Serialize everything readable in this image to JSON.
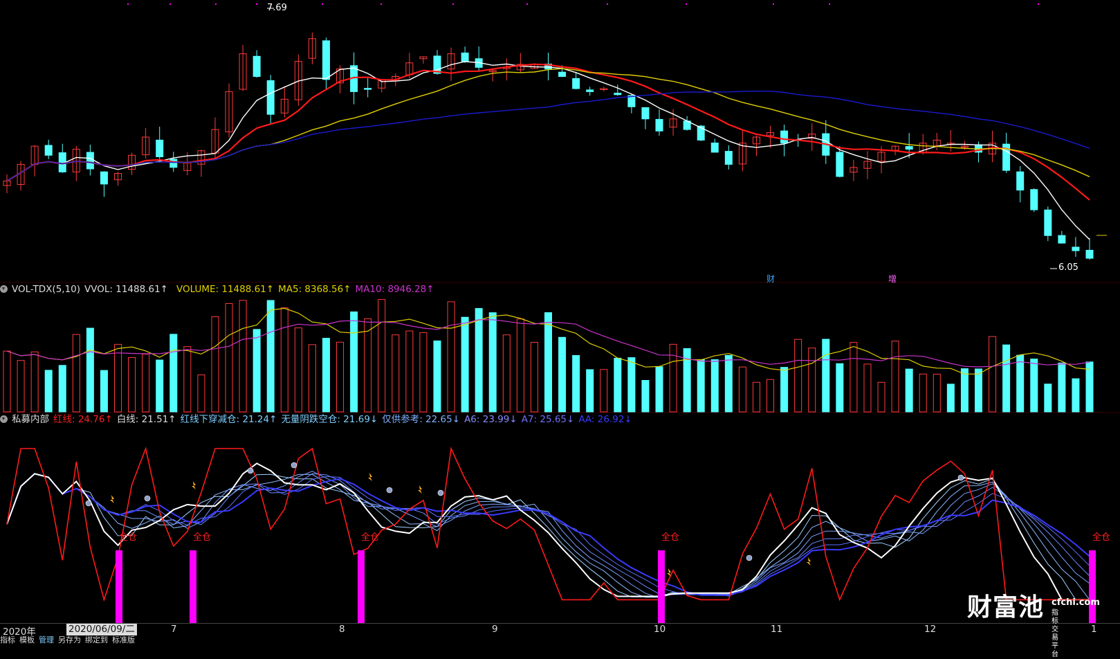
{
  "price_panel": {
    "high_label": "7.69",
    "low_label": "6.05",
    "event_tags": [
      "财",
      "增"
    ]
  },
  "volume_panel": {
    "indicator_name": "VOL-TDX(5,10)",
    "vvol": "VVOL: 11488.61↑",
    "volume": "VOLUME: 11488.61↑",
    "ma5": "MA5: 8368.56↑",
    "ma10": "MA10: 8946.28↑"
  },
  "indicator_panel": {
    "name": "私募内部",
    "red_line": "红线: 24.76↑",
    "white_line": "白线: 21.51↑",
    "red_cross": "红线下穿减仓: 21.24↑",
    "no_bear": "无量阴跌空仓: 21.69↓",
    "reference": "仅供参考: 22.65↓",
    "a6": "A6: 23.99↓",
    "a7": "A7: 25.65↓",
    "aa": "AA: 26.92↓",
    "signal_label": "全仓"
  },
  "x_axis": {
    "year": "2020年",
    "cursor_date": "2020/06/09/二",
    "months": [
      "7",
      "8",
      "9",
      "10",
      "11",
      "12",
      "1"
    ]
  },
  "bottom_tabs": [
    "指标",
    "模板",
    "管理",
    "另存为",
    "绑定到",
    "标准版"
  ],
  "watermark": {
    "brand": "财富池",
    "site": "cfchi.com",
    "slogan": "指标交易平台"
  },
  "colors": {
    "up": "#ff3b3b",
    "down": "#54ffff",
    "ma_white": "#ffffff",
    "ma_red": "#ff1a1a",
    "ma_yellow": "#e0d000",
    "ma_blue": "#1a1ad0",
    "volume_ma5": "#e0d000",
    "volume_ma10": "#cc33cc",
    "signal_bar": "#ff00ff",
    "aa_blue": "#3a3aff"
  },
  "chart_data": [
    {
      "type": "candlestick",
      "title": "",
      "series": [
        {
          "name": "",
          "values": [
            6.61,
            6.72,
            6.84,
            6.78,
            6.67,
            6.82,
            6.69,
            6.59,
            6.66,
            6.78,
            6.9,
            6.77,
            6.7,
            6.73,
            6.81,
            6.95,
            7.2,
            7.45,
            7.3,
            7.05,
            7.15,
            7.4,
            7.55,
            7.28,
            7.35,
            7.2,
            7.22,
            7.28,
            7.3,
            7.39,
            7.43,
            7.32,
            7.45,
            7.4,
            7.36,
            7.34,
            7.36,
            7.38,
            7.38,
            7.35,
            7.3,
            7.22,
            7.2,
            7.22,
            7.18,
            7.1,
            7.02,
            6.94,
            7.02,
            6.95,
            6.88,
            6.8,
            6.72,
            6.86,
            6.9,
            6.93,
            6.86,
            6.88,
            6.92,
            6.78,
            6.64,
            6.7,
            6.74,
            6.8,
            6.84,
            6.82,
            6.86,
            6.88,
            6.86,
            6.84,
            6.8,
            6.86,
            6.68,
            6.55,
            6.42,
            6.25,
            6.2,
            6.15,
            6.1
          ]
        }
      ],
      "x_tick_labels": [
        "7",
        "8",
        "9",
        "10",
        "11",
        "12",
        "1"
      ],
      "annotations": [
        "7.69",
        "6.05"
      ]
    },
    {
      "type": "bar",
      "title": "VOL-TDX(5,10)",
      "series": [
        {
          "name": "VOLUME",
          "values": [
            11488.61
          ]
        },
        {
          "name": "MA5",
          "values": [
            8368.56
          ]
        },
        {
          "name": "MA10",
          "values": [
            8946.28
          ]
        }
      ]
    },
    {
      "type": "line",
      "title": "私募内部",
      "series": [
        {
          "name": "红线",
          "values": [
            24.76
          ]
        },
        {
          "name": "白线",
          "values": [
            21.51
          ]
        },
        {
          "name": "红线下穿减仓",
          "values": [
            21.24
          ]
        },
        {
          "name": "无量阴跌空仓",
          "values": [
            21.69
          ]
        },
        {
          "name": "仅供参考",
          "values": [
            22.65
          ]
        },
        {
          "name": "A6",
          "values": [
            23.99
          ]
        },
        {
          "name": "A7",
          "values": [
            25.65
          ]
        },
        {
          "name": "AA",
          "values": [
            26.92
          ]
        }
      ],
      "annotations": [
        "全仓"
      ]
    }
  ]
}
